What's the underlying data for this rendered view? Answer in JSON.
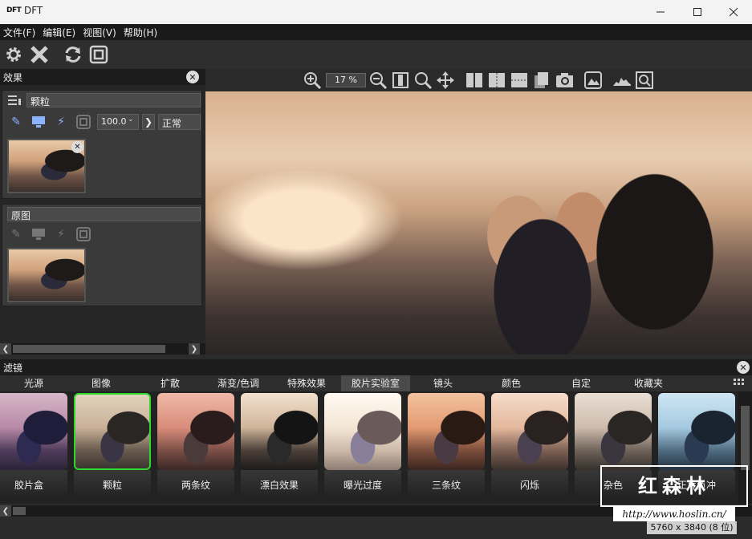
{
  "window": {
    "logo_text": "DFT",
    "title": "DFT"
  },
  "menu": [
    "文件(F)",
    "编辑(E)",
    "视图(V)",
    "帮助(H)"
  ],
  "left_panel": {
    "title": "效果",
    "effect": {
      "name": "颗粒",
      "value": "100.0",
      "mode": "正常"
    },
    "original": {
      "name": "原图"
    }
  },
  "viewer": {
    "zoom": "17 %"
  },
  "filters": {
    "title": "滤镜",
    "tabs": [
      "光源",
      "图像",
      "扩散",
      "渐变/色调",
      "特殊效果",
      "胶片实验室",
      "镜头",
      "颜色",
      "自定",
      "收藏夹"
    ],
    "active_tab_index": 5,
    "items": [
      "胶片盒",
      "颗粒",
      "两条纹",
      "漂白效果",
      "曝光过度",
      "三条纹",
      "闪烁",
      "杂色",
      "正片负冲"
    ],
    "selected_index": 1
  },
  "status": {
    "image_info": "5760 x 3840 (8 位)"
  },
  "watermark": {
    "name": "红森林",
    "url": "http://www.hoslin.cn/"
  },
  "colors": {
    "selected_border": "#2ed82e",
    "accent_icon": "#8ab4ff"
  }
}
